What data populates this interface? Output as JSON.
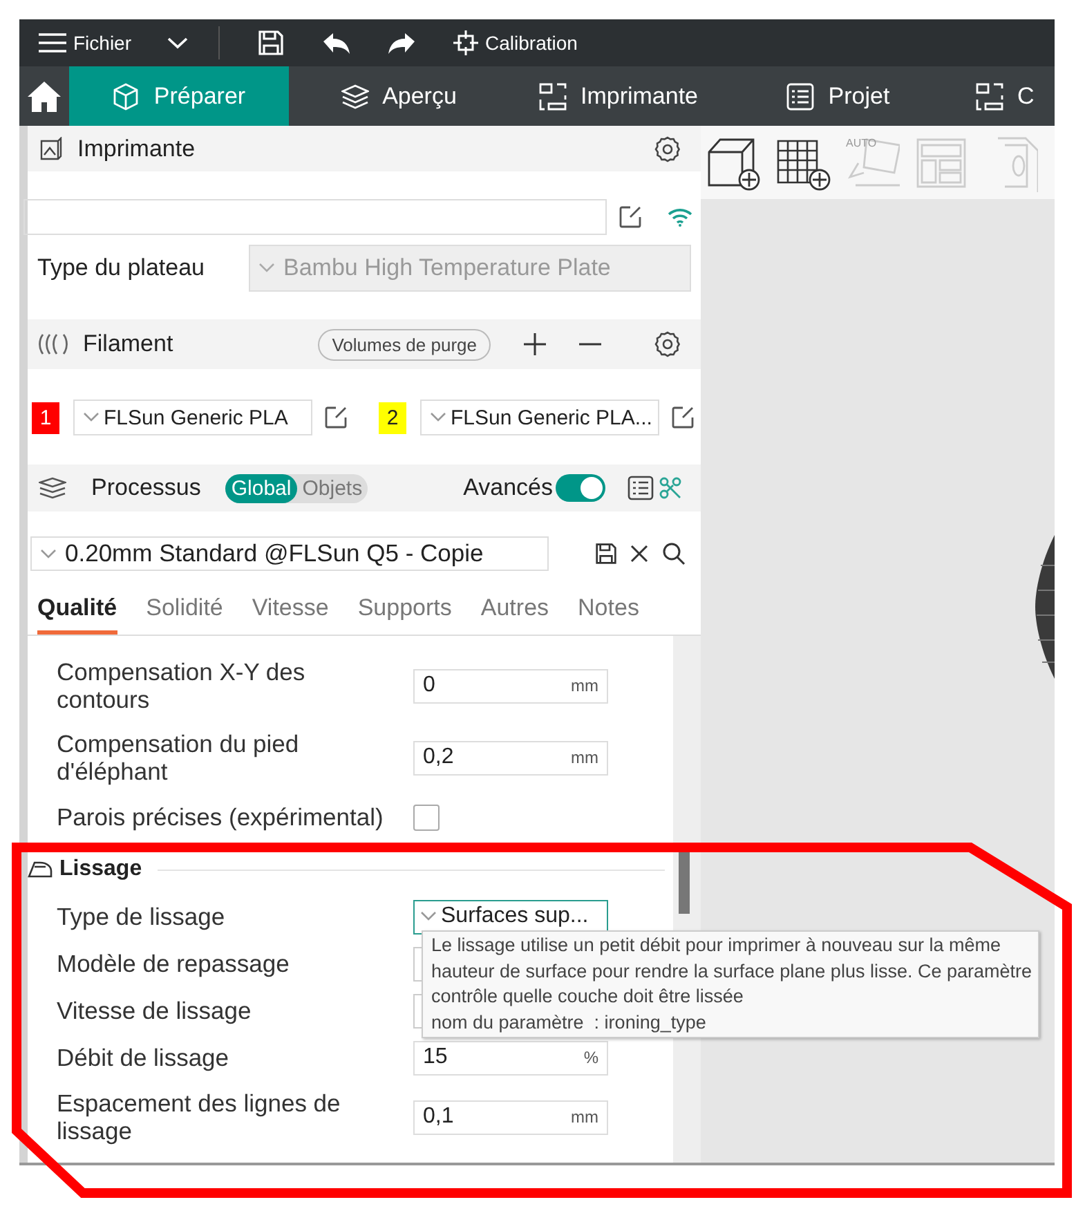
{
  "toolbar": {
    "menu_label": "Fichier",
    "calibration_label": "Calibration"
  },
  "nav_tabs": [
    {
      "label": "Préparer",
      "selected": true
    },
    {
      "label": "Aperçu",
      "selected": false
    },
    {
      "label": "Imprimante",
      "selected": false
    },
    {
      "label": "Projet",
      "selected": false
    },
    {
      "label": "C",
      "selected": false
    }
  ],
  "viewport_toolbar": {
    "auto_label": "AUTO"
  },
  "printer": {
    "title": "Imprimante",
    "plate_label": "Type du plateau",
    "plate_value": "Bambu High Temperature Plate",
    "plate_disabled": true
  },
  "filament": {
    "title": "Filament",
    "purge_button": "Volumes de purge",
    "slots": [
      {
        "number": "1",
        "color": "#ff0000",
        "name": "FLSun Generic PLA"
      },
      {
        "number": "2",
        "color": "#ffff00",
        "name": "FLSun Generic PLA..."
      }
    ]
  },
  "process": {
    "title": "Processus",
    "scope": [
      {
        "label": "Global",
        "selected": true
      },
      {
        "label": "Objets",
        "selected": false
      }
    ],
    "advanced_label": "Avancés",
    "advanced_on": true,
    "preset": "0.20mm Standard @FLSun Q5 - Copie"
  },
  "tabs": [
    {
      "label": "Qualité",
      "selected": true
    },
    {
      "label": "Solidité",
      "selected": false
    },
    {
      "label": "Vitesse",
      "selected": false
    },
    {
      "label": "Supports",
      "selected": false
    },
    {
      "label": "Autres",
      "selected": false
    },
    {
      "label": "Notes",
      "selected": false
    }
  ],
  "settings": [
    {
      "kind": "field",
      "label": "Compensation X-Y des contours",
      "value": "0",
      "unit": "mm"
    },
    {
      "kind": "field",
      "label": "Compensation du pied d'éléphant",
      "value": "0,2",
      "unit": "mm"
    },
    {
      "kind": "checkbox",
      "label": "Parois précises (expérimental)",
      "checked": false
    },
    {
      "kind": "section",
      "label": "Lissage"
    },
    {
      "kind": "combo",
      "label": "Type de lissage",
      "value": "Surfaces sup...",
      "focused": true
    },
    {
      "kind": "field",
      "label": "Modèle de repassage"
    },
    {
      "kind": "field",
      "label": "Vitesse de lissage"
    },
    {
      "kind": "field",
      "label": "Débit de lissage",
      "value": "15",
      "unit": "%"
    },
    {
      "kind": "field",
      "label": "Espacement des lignes de lissage",
      "value": "0,1",
      "unit": "mm"
    }
  ],
  "tooltip": {
    "lines": [
      "Le lissage utilise un petit débit pour imprimer à nouveau sur la même",
      "hauteur de surface pour rendre la surface plane plus lisse. Ce paramètre",
      "contrôle quelle couche doit être lissée",
      "nom du paramètre  : ironing_type"
    ]
  }
}
